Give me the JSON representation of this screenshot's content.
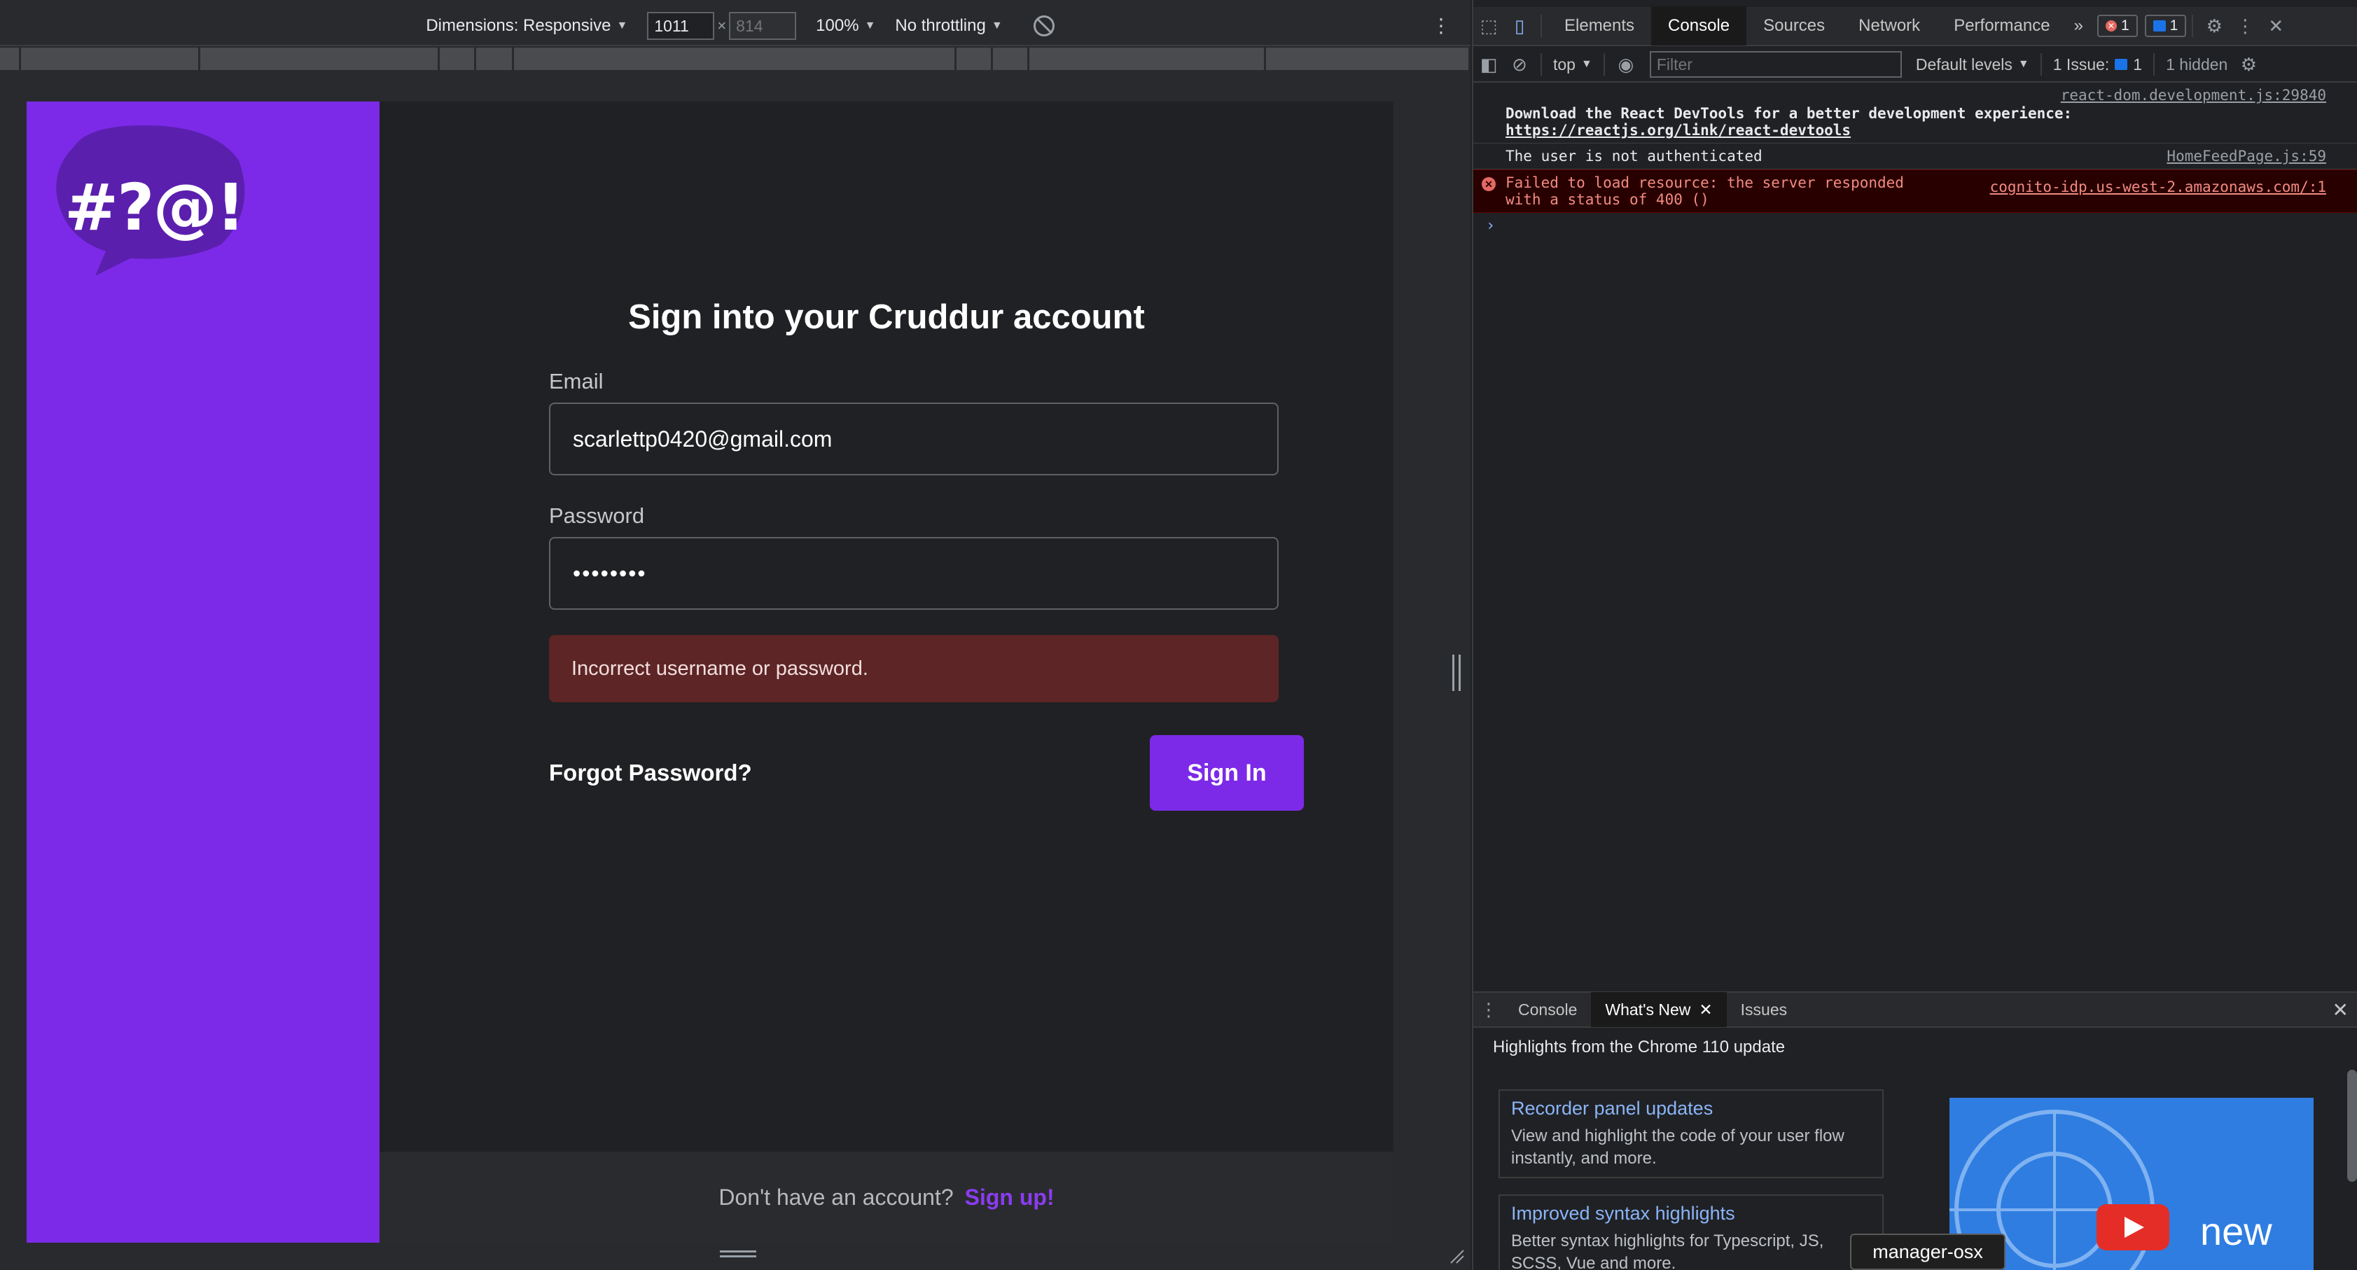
{
  "device_toolbar": {
    "dimensions_label": "Dimensions: Responsive",
    "width_value": "1011",
    "times": "×",
    "height_placeholder": "814",
    "zoom": "100%",
    "throttling": "No throttling"
  },
  "app": {
    "logo_text": "#?@!",
    "form_title": "Sign into your Cruddur account",
    "email_label": "Email",
    "email_value": "scarlettp0420@gmail.com",
    "password_label": "Password",
    "password_value": "••••••••",
    "error_message": "Incorrect username or password.",
    "forgot_password": "Forgot Password?",
    "sign_in_button": "Sign In",
    "footer_text": "Don't have an account?",
    "signup_link": "Sign up!",
    "brand_color": "#7c2ae8",
    "error_bg_color": "#5d2525"
  },
  "devtools": {
    "tabs": [
      "Elements",
      "Console",
      "Sources",
      "Network",
      "Performance"
    ],
    "more_tabs": "»",
    "error_count": "1",
    "message_count": "1",
    "console_toolbar": {
      "context": "top",
      "filter_placeholder": "Filter",
      "levels": "Default levels",
      "issues": "1 Issue:",
      "issues_count": "1",
      "hidden": "1 hidden"
    },
    "log": {
      "line1_src": "react-dom.development.js:29840",
      "line1_text": "Download the React DevTools for a better development experience: ",
      "line1_link": "https://reactjs.org/link/react-devtools",
      "line2_text": "The user is not authenticated",
      "line2_src": "HomeFeedPage.js:59",
      "line3_text": "Failed to load resource: the server responded with a status of 400 ()",
      "line3_src": "cognito-idp.us-west-2.amazonaws.com/:1",
      "prompt": "›"
    },
    "drawer": {
      "tabs": [
        "Console",
        "What's New",
        "Issues"
      ],
      "heading": "Highlights from the Chrome 110 update",
      "card1_title": "Recorder panel updates",
      "card1_desc": "View and highlight the code of your user flow instantly, and more.",
      "card2_title": "Improved syntax highlights",
      "card2_desc": "Better syntax highlights for Typescript, JS, SCSS, Vue and more.",
      "video_word": "new"
    }
  },
  "tooltip": "manager-osx"
}
